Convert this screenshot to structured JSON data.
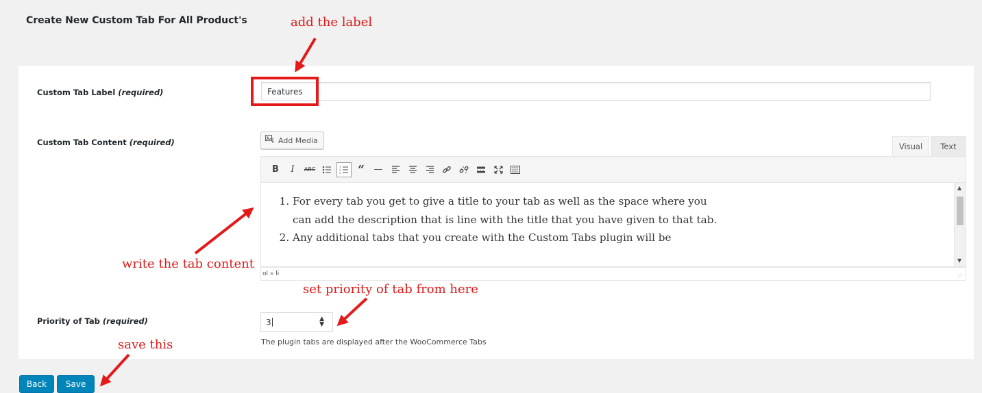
{
  "page": {
    "title": "Create New Custom Tab For All Product's"
  },
  "fields": {
    "label": {
      "name": "Custom Tab Label",
      "required_note": "(required)",
      "value": "Features"
    },
    "content": {
      "name": "Custom Tab Content",
      "required_note": "(required)",
      "add_media_label": "Add Media",
      "tabs": [
        "Visual",
        "Text"
      ],
      "toolbar_icons": [
        "bold-icon",
        "italic-icon",
        "strikethrough-icon",
        "bullet-list-icon",
        "numbered-list-icon",
        "blockquote-icon",
        "horizontal-rule-icon",
        "align-left-icon",
        "align-center-icon",
        "align-right-icon",
        "link-icon",
        "unlink-icon",
        "read-more-icon",
        "fullscreen-icon",
        "toolbar-toggle-icon"
      ],
      "items": [
        "For every tab you get to give a title to your tab as well as the space where you can add the description that is line with the title that you have given to that tab.",
        "Any additional tabs that you create with the Custom Tabs plugin will be"
      ],
      "status_path": "ol » li"
    },
    "priority": {
      "name": "Priority of Tab",
      "required_note": "(required)",
      "value": "3",
      "help": "The plugin tabs are displayed after the WooCommerce Tabs"
    }
  },
  "buttons": {
    "back": "Back",
    "save": "Save"
  },
  "annotations": {
    "add_label": "add the label",
    "write_content": "write the tab content",
    "set_priority": "set priority of tab from here",
    "save_this": "save this"
  },
  "colors": {
    "annotation": "#e01919",
    "primary_button": "#0085ba"
  }
}
